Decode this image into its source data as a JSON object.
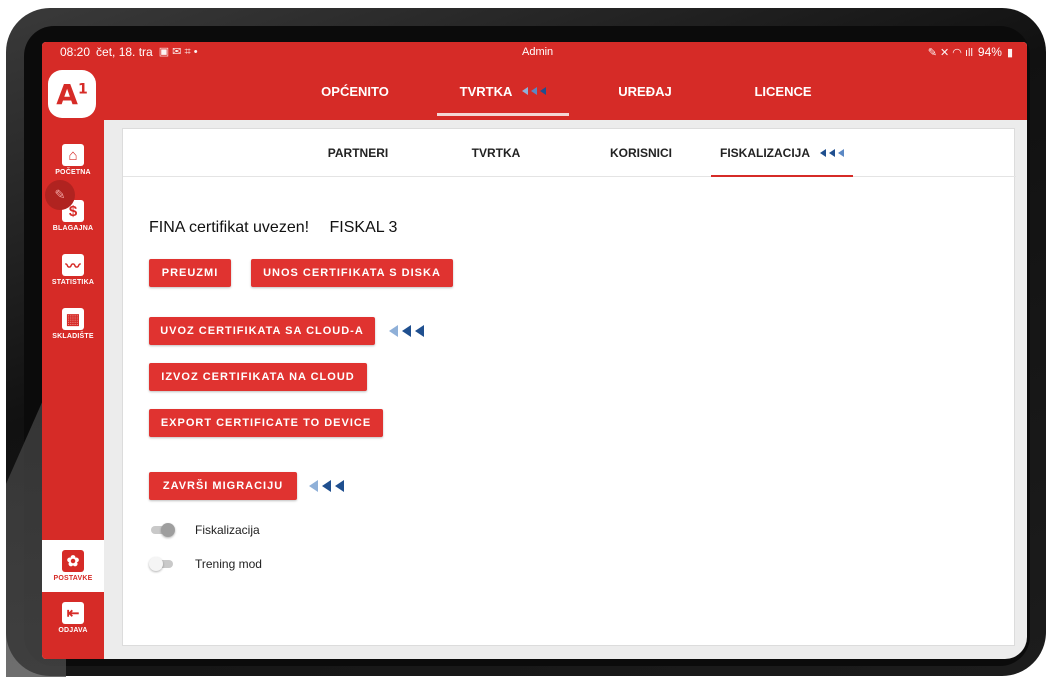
{
  "status_bar": {
    "time": "08:20",
    "date": "čet, 18. tra",
    "center": "Admin",
    "battery": "94%"
  },
  "logo": {
    "text": "A",
    "sup": "1"
  },
  "top_tabs": [
    {
      "label": "OPĆENITO",
      "active": false
    },
    {
      "label": "TVRTKA",
      "active": true
    },
    {
      "label": "UREĐAJ",
      "active": false
    },
    {
      "label": "LICENCE",
      "active": false
    }
  ],
  "sidebar": {
    "items": [
      {
        "label": "POČETNA",
        "icon": "home-icon",
        "glyph": "⌂"
      },
      {
        "label": "BLAGAJNA",
        "icon": "dollar-icon",
        "glyph": "$"
      },
      {
        "label": "STATISTIKA",
        "icon": "chart-icon",
        "glyph": "〰"
      },
      {
        "label": "SKLADIŠTE",
        "icon": "warehouse-icon",
        "glyph": "▦"
      },
      {
        "label": "POSTAVKE",
        "icon": "gear-icon",
        "glyph": "✿",
        "active": true
      },
      {
        "label": "ODJAVA",
        "icon": "logout-icon",
        "glyph": "⇤"
      }
    ]
  },
  "sub_tabs": [
    {
      "label": "PARTNERI",
      "active": false
    },
    {
      "label": "TVRTKA",
      "active": false
    },
    {
      "label": "KORISNICI",
      "active": false
    },
    {
      "label": "FISKALIZACIJA",
      "active": true
    }
  ],
  "heading": {
    "status": "FINA certifikat uvezen!",
    "name": "FISKAL 3"
  },
  "buttons": {
    "preuzmi": "PREUZMI",
    "unos": "UNOS CERTIFIKATA S DISKA",
    "uvoz_cloud": "UVOZ CERTIFIKATA SA CLOUD-A",
    "izvoz_cloud": "IZVOZ CERTIFIKATA NA CLOUD",
    "export_device": "EXPORT CERTIFICATE TO DEVICE",
    "zavrsi": "ZAVRŠI MIGRACIJU"
  },
  "toggles": [
    {
      "label": "Fiskalizacija",
      "on": true
    },
    {
      "label": "Trening mod",
      "on": false
    }
  ],
  "colors": {
    "brand_red": "#d62b27",
    "arrow_blue": "#1f4f8f",
    "toggle_on_knob": "#9e9e9e",
    "toggle_off_knob": "#f5f5f5"
  }
}
